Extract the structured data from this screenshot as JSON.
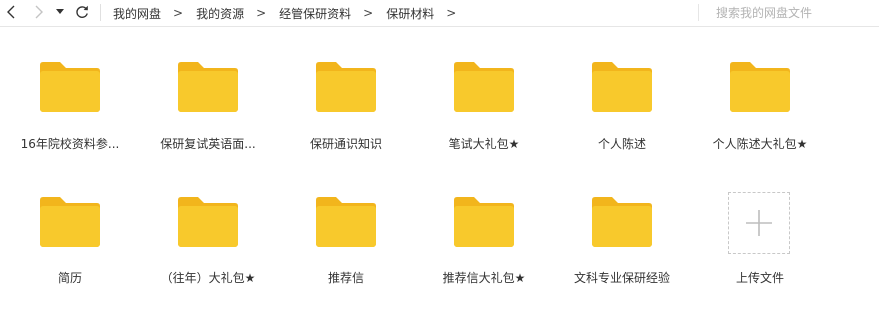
{
  "toolbar": {
    "back_icon": "chevron-left-icon",
    "forward_icon": "chevron-right-icon",
    "dropdown_icon": "caret-down-icon",
    "refresh_icon": "refresh-icon",
    "breadcrumbs": [
      "我的网盘",
      "我的资源",
      "经管保研资料",
      "保研材料"
    ],
    "separator": ">",
    "search_placeholder": "搜索我的网盘文件"
  },
  "folders": [
    {
      "name": "16年院校资料参..."
    },
    {
      "name": "保研复试英语面..."
    },
    {
      "name": "保研通识知识"
    },
    {
      "name": "笔试大礼包★"
    },
    {
      "name": "个人陈述"
    },
    {
      "name": "个人陈述大礼包★"
    },
    {
      "name": "简历"
    },
    {
      "name": "（往年）大礼包★"
    },
    {
      "name": "推荐信"
    },
    {
      "name": "推荐信大礼包★"
    },
    {
      "name": "文科专业保研经验"
    }
  ],
  "upload": {
    "label": "上传文件",
    "icon": "plus-icon"
  },
  "colors": {
    "folder_body": "#F8C92C",
    "folder_tab": "#F2B51C",
    "text": "#333333",
    "muted": "#B3B3B3"
  }
}
